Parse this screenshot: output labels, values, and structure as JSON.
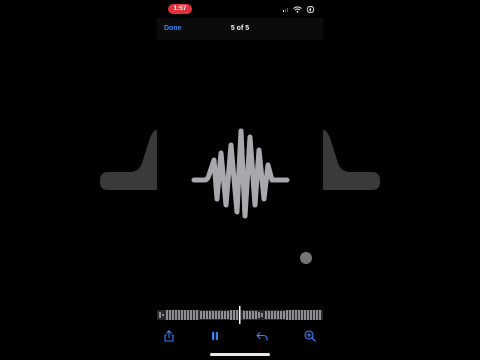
{
  "status": {
    "time": "1:57"
  },
  "topbar": {
    "done_label": "Done",
    "counter": "5 of 5"
  },
  "colors": {
    "accent": "#3a82f7",
    "time_pill": "#e0313a",
    "wave": "#a9a9ad"
  },
  "icons": {
    "share": "share-icon",
    "pause": "pause-icon",
    "undo": "undo-icon",
    "zoom": "zoom-in-icon",
    "signal": "signal-icon",
    "wifi": "wifi-icon",
    "battery": "battery-icon"
  }
}
